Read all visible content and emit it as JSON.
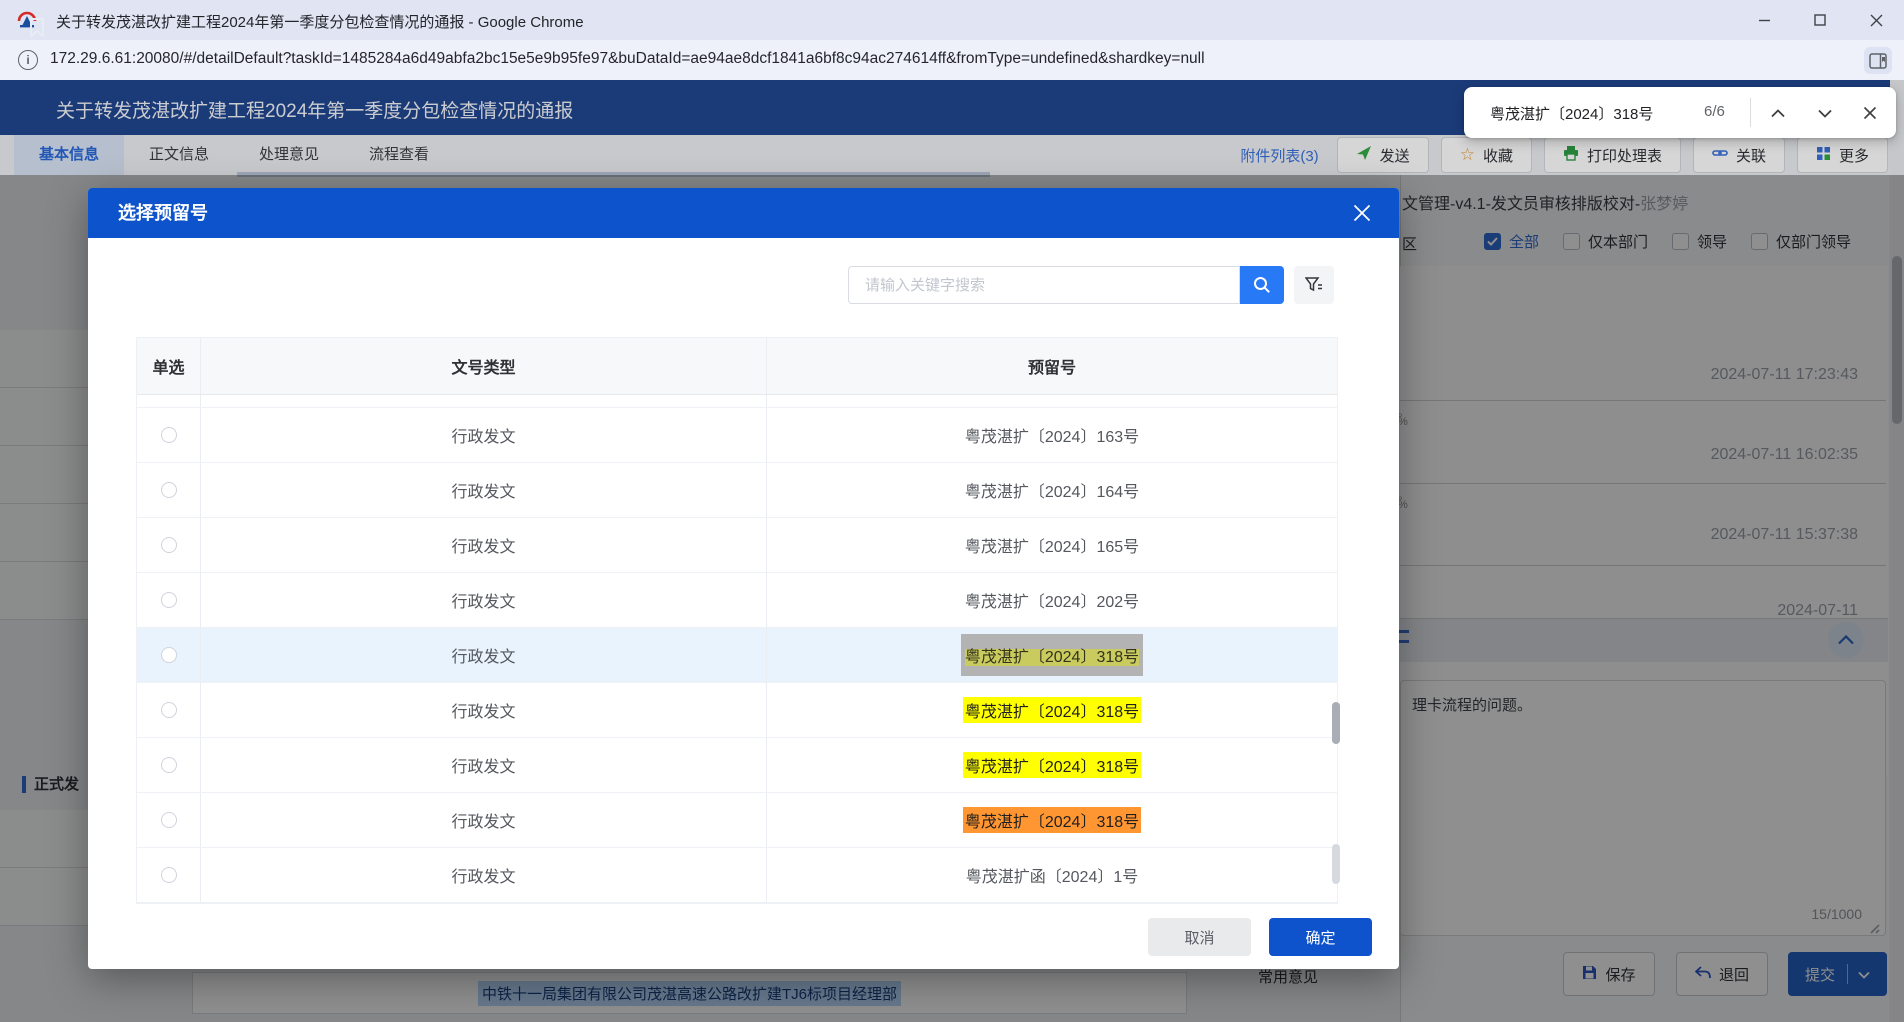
{
  "window": {
    "title": "关于转发茂湛改扩建工程2024年第一季度分包检查情况的通报 - Google Chrome"
  },
  "browser": {
    "url": "172.29.6.61:20080/#/detailDefault?taskId=1485284a6d49abfa2bc15e5e9b95fe97&buDataId=ae94ae8dcf1841a6bf8c94ac274614ff&fromType=undefined&shardkey=null",
    "find_bar": {
      "query": "粤茂湛扩〔2024〕318号",
      "match_count": "6/6"
    }
  },
  "page": {
    "title": "关于转发茂湛改扩建工程2024年第一季度分包检查情况的通报",
    "tabs": [
      {
        "label": "基本信息",
        "active": true
      },
      {
        "label": "正文信息",
        "active": false
      },
      {
        "label": "处理意见",
        "active": false
      },
      {
        "label": "流程查看",
        "active": false
      }
    ],
    "toolbar": {
      "attachments": "附件列表(3)",
      "buttons": [
        "发送",
        "收藏",
        "打印处理表",
        "关联",
        "更多"
      ]
    }
  },
  "modal": {
    "title": "选择预留号",
    "search_placeholder": "请输入关键字搜索",
    "table": {
      "columns": [
        "单选",
        "文号类型",
        "预留号"
      ],
      "rows": [
        {
          "type": "行政发文",
          "number": "粤茂湛扩〔2024〕163号",
          "highlight": "none",
          "row_selected": false
        },
        {
          "type": "行政发文",
          "number": "粤茂湛扩〔2024〕164号",
          "highlight": "none",
          "row_selected": false
        },
        {
          "type": "行政发文",
          "number": "粤茂湛扩〔2024〕165号",
          "highlight": "none",
          "row_selected": false
        },
        {
          "type": "行政发文",
          "number": "粤茂湛扩〔2024〕202号",
          "highlight": "none",
          "row_selected": false
        },
        {
          "type": "行政发文",
          "number": "粤茂湛扩〔2024〕318号",
          "highlight": "selected",
          "row_selected": true
        },
        {
          "type": "行政发文",
          "number": "粤茂湛扩〔2024〕318号",
          "highlight": "yellow",
          "row_selected": false
        },
        {
          "type": "行政发文",
          "number": "粤茂湛扩〔2024〕318号",
          "highlight": "yellow",
          "row_selected": false
        },
        {
          "type": "行政发文",
          "number": "粤茂湛扩〔2024〕318号",
          "highlight": "orange",
          "row_selected": false
        },
        {
          "type": "行政发文",
          "number": "粤茂湛扩函〔2024〕1号",
          "highlight": "none",
          "row_selected": false
        }
      ]
    },
    "cancel_label": "取消",
    "confirm_label": "确定"
  },
  "right_panel": {
    "workflow_title_main": "文管理-v4.1-发文员审核排版校对-",
    "workflow_title_name": "张梦婷",
    "fragment": "区",
    "filters": [
      {
        "label": "全部",
        "checked": true
      },
      {
        "label": "仅本部门",
        "checked": false
      },
      {
        "label": "领导",
        "checked": false
      },
      {
        "label": "仅部门领导",
        "checked": false
      }
    ],
    "timestamps": [
      "2024-07-11 17:23:43",
      "2024-07-11 16:02:35",
      "2024-07-11 15:37:38"
    ],
    "timestamp_partial": "2024-07-11",
    "fragment_dot": "。",
    "fragment_pct": "%",
    "opinion_text": "理卡流程的问题。",
    "char_counter": "15/1000",
    "common_opinion_label": "常用意见",
    "save_label": "保存",
    "return_label": "退回",
    "submit_label": "提交"
  },
  "left_panel": {
    "section_label": "正式发",
    "company_text": "中铁十一局集团有限公司茂湛高速公路改扩建TJ6标项目经理部"
  },
  "colors": {
    "modal_header_blue": "#0d53cc",
    "search_button_blue": "#2779f5",
    "find_match_yellow": "#ffff00",
    "find_active_orange": "#ff9632",
    "selected_row_blue": "#e9f3fd"
  }
}
